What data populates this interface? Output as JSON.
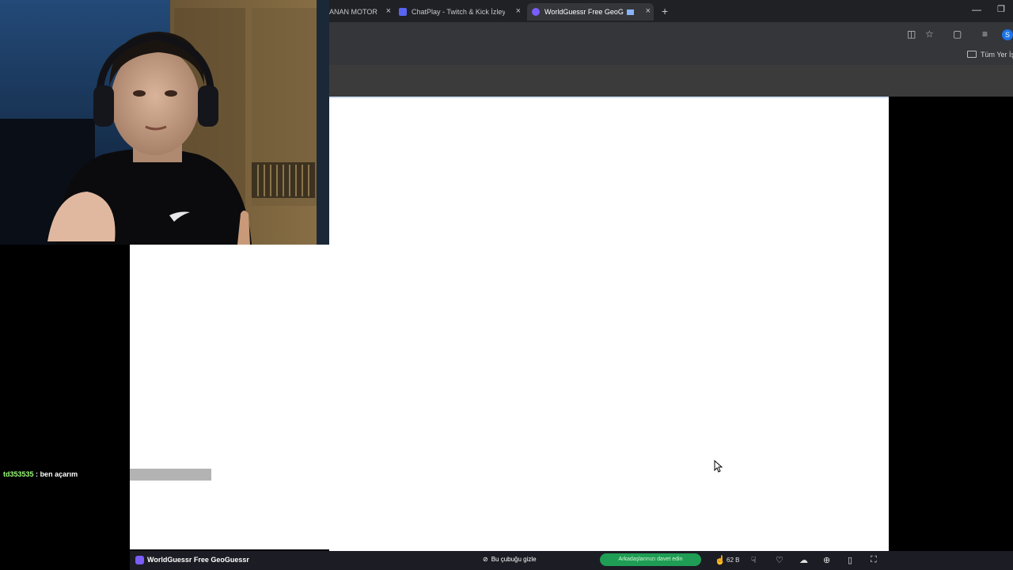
{
  "browser": {
    "tabs": [
      {
        "label": "ANAN MOTOR",
        "active": false
      },
      {
        "label": "ChatPlay - Twitch & Kick İzleyic",
        "active": false
      },
      {
        "label": "WorldGuessr Free GeoGues",
        "active": true
      }
    ],
    "new_tab_symbol": "+",
    "close_symbol": "×",
    "profile_initial": "S",
    "bookmark_folder_label": "Tüm Yer İşa"
  },
  "chat": {
    "username": "td353535",
    "separator": ":",
    "message": "ben açarım"
  },
  "game_bar": {
    "title": "WorldGuessr Free GeoGuessr",
    "hide_bar_label": "Bu çubuğu gizle",
    "invite_label": "Arkadaşlarınızı davet edin",
    "like_count": "62 B"
  },
  "colors": {
    "tab_strip": "#202124",
    "toolbar": "#35363a",
    "invite_green": "#1f9d55",
    "game_accent": "#7b5cff",
    "chat_username": "#9cff7a"
  },
  "icons": [
    "install-icon",
    "star-icon",
    "extensions-icon",
    "tab-search-icon",
    "eye-off-icon",
    "thumbs-up-icon",
    "thumbs-down-icon",
    "heart-icon",
    "cloud-icon",
    "crosshair-icon",
    "phone-icon",
    "fullscreen-icon",
    "cursor-icon"
  ]
}
